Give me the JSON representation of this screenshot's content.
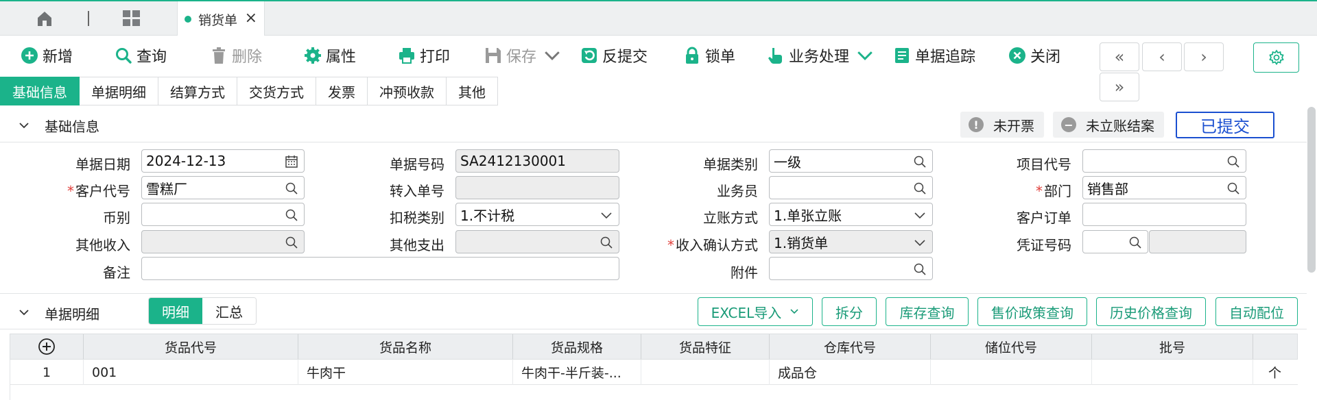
{
  "window": {
    "active_tab": "销货单"
  },
  "toolbar": {
    "new": "新增",
    "query": "查询",
    "delete": "删除",
    "properties": "属性",
    "print": "打印",
    "save": "保存",
    "unsubmit": "反提交",
    "lock": "锁单",
    "business": "业务处理",
    "trace": "单据追踪",
    "close": "关闭",
    "nav_first": "«",
    "nav_prev": "‹",
    "nav_next": "›",
    "nav_last": "»"
  },
  "subtabs": [
    "基础信息",
    "单据明细",
    "结算方式",
    "交货方式",
    "发票",
    "冲预收款",
    "其他"
  ],
  "basic_section": {
    "title": "基础信息",
    "status_invoice": "未开票",
    "status_settle": "未立账结案",
    "status_submitted": "已提交"
  },
  "form": {
    "doc_date": {
      "label": "单据日期",
      "value": "2024-12-13"
    },
    "customer_code": {
      "label": "客户代号",
      "value": "雪糕厂"
    },
    "currency": {
      "label": "币别",
      "value": ""
    },
    "other_income": {
      "label": "其他收入",
      "value": ""
    },
    "remark": {
      "label": "备注",
      "value": ""
    },
    "doc_no": {
      "label": "单据号码",
      "value": "SA2412130001"
    },
    "transfer_no": {
      "label": "转入单号",
      "value": ""
    },
    "tax_type": {
      "label": "扣税类别",
      "value": "1.不计税"
    },
    "other_expense": {
      "label": "其他支出",
      "value": ""
    },
    "doc_category": {
      "label": "单据类别",
      "value": "一级"
    },
    "salesman": {
      "label": "业务员",
      "value": ""
    },
    "account_method": {
      "label": "立账方式",
      "value": "1.单张立账"
    },
    "revenue_confirm": {
      "label": "收入确认方式",
      "value": "1.销货单"
    },
    "attachment": {
      "label": "附件",
      "value": ""
    },
    "project_code": {
      "label": "项目代号",
      "value": ""
    },
    "department": {
      "label": "部门",
      "value": "销售部"
    },
    "customer_order": {
      "label": "客户订单",
      "value": ""
    },
    "voucher_no": {
      "label": "凭证号码",
      "value": ""
    }
  },
  "detail_section": {
    "title": "单据明细",
    "seg_detail": "明细",
    "seg_summary": "汇总",
    "excel_import": "EXCEL导入",
    "split": "拆分",
    "stock_query": "库存查询",
    "price_policy_query": "售价政策查询",
    "history_price_query": "历史价格查询",
    "auto_allocate": "自动配位"
  },
  "table": {
    "columns": [
      "货品代号",
      "货品名称",
      "货品规格",
      "货品特征",
      "仓库代号",
      "储位代号",
      "批号"
    ],
    "rows": [
      {
        "index": "1",
        "code": "001",
        "name": "牛肉干",
        "spec": "牛肉干-半斤装-...",
        "feature": "",
        "warehouse": "成品仓",
        "location": "",
        "batch": "",
        "unit": "个"
      }
    ]
  },
  "colors": {
    "accent": "#1bb38a",
    "submitted": "#1a4fd0",
    "required": "#e0403c"
  }
}
